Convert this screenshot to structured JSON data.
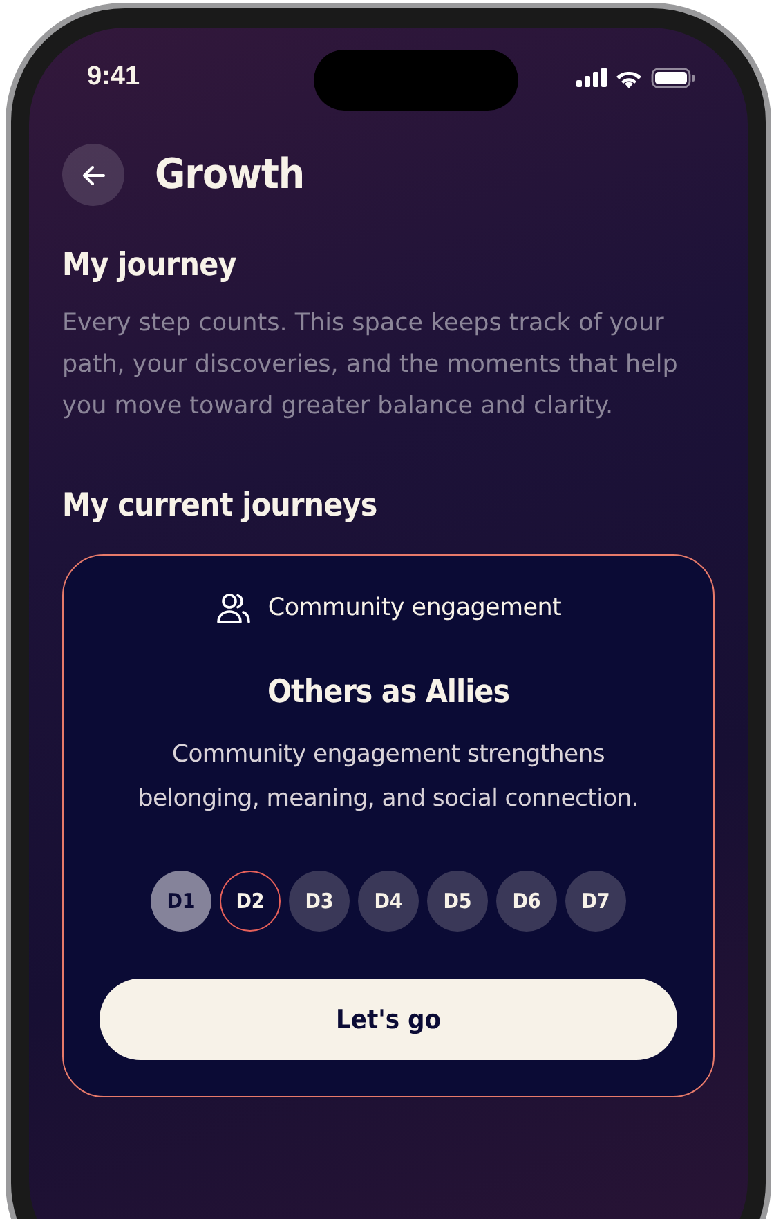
{
  "status_bar": {
    "time": "9:41"
  },
  "header": {
    "title": "Growth"
  },
  "intro": {
    "title": "My journey",
    "text": "Every step counts. This space keeps track of your path, your discoveries, and the moments that help you move toward greater balance and clarity."
  },
  "current": {
    "title": "My current journeys",
    "card": {
      "category": "Community engagement",
      "title": "Others as Allies",
      "text": "Community engagement strengthens belonging, meaning, and social connection.",
      "days": [
        {
          "label": "D1",
          "done": true,
          "selected": false
        },
        {
          "label": "D2",
          "done": false,
          "selected": true
        },
        {
          "label": "D3",
          "done": false,
          "selected": false
        },
        {
          "label": "D4",
          "done": false,
          "selected": false
        },
        {
          "label": "D5",
          "done": false,
          "selected": false
        },
        {
          "label": "D6",
          "done": false,
          "selected": false
        },
        {
          "label": "D7",
          "done": false,
          "selected": false
        }
      ],
      "button": "Let's go"
    }
  }
}
